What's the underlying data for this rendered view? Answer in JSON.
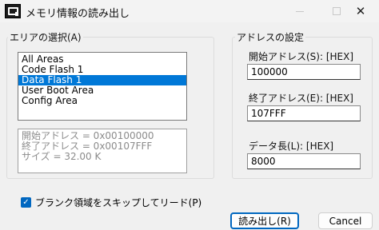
{
  "window": {
    "title": "メモリ情報の読み出し",
    "minimize_glyph": "",
    "close_glyph": "✕"
  },
  "area_select": {
    "label": "エリアの選択(A)",
    "items": [
      "All Areas",
      "Code Flash 1",
      "Data Flash 1",
      "User Boot Area",
      "Config Area"
    ],
    "selected_index": 2,
    "info_lines": [
      "開始アドレス = 0x00100000",
      "終了アドレス = 0x00107FFF",
      "サイズ = 32.00 K"
    ]
  },
  "address": {
    "label": "アドレスの設定",
    "start_label": "開始アドレス(S): [HEX]",
    "start_value": "100000",
    "end_label": "終了アドレス(E): [HEX]",
    "end_value": "107FFF",
    "length_label": "データ長(L): [HEX]",
    "length_value": "8000"
  },
  "skip_blank": {
    "label": "ブランク領域をスキップしてリード(P)",
    "checked": true
  },
  "buttons": {
    "read_label": "読み出し(R)",
    "cancel_label": "Cancel"
  },
  "colors": {
    "accent": "#0067c0",
    "selection": "#0078d7",
    "client_bg": "#f0f0f0"
  }
}
